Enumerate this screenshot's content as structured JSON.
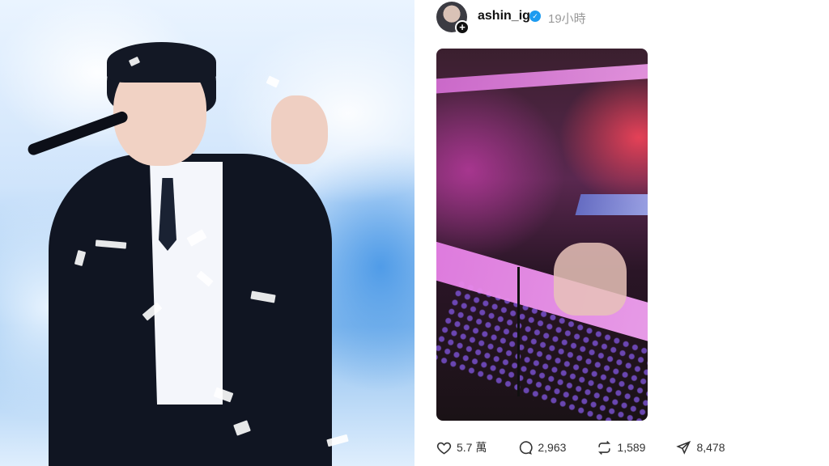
{
  "post": {
    "username": "ashin_ig",
    "time": "19小時",
    "avatar_plus": "+",
    "verified_mark": "✓"
  },
  "actions": {
    "likes": "5.7 萬",
    "comments": "2,963",
    "reposts": "1,589",
    "shares": "8,478"
  },
  "icons": {
    "heart": "heart-icon",
    "comment": "comment-icon",
    "repost": "repost-icon",
    "share": "share-icon",
    "verified": "verified-badge-icon"
  },
  "colors": {
    "verified": "#1d9bf0",
    "text": "#111111",
    "muted": "#999999"
  }
}
